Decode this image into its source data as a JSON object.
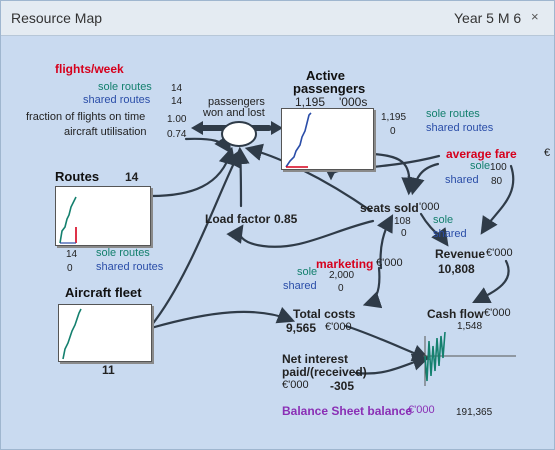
{
  "window": {
    "title": "Resource Map",
    "period": "Year 5 M 6",
    "close_glyph": "×"
  },
  "flights": {
    "title": "flights/week",
    "sole_label": "sole routes",
    "sole_value": "14",
    "shared_label": "shared routes",
    "shared_value": "14",
    "ontime_label": "fraction of flights on time",
    "ontime_value": "1.00",
    "util_label": "aircraft utilisation",
    "util_value": "0.74"
  },
  "flow": {
    "line1": "passengers",
    "line2": "won and lost"
  },
  "passengers": {
    "title_line1": "Active",
    "title_line2": "passengers",
    "total": "1,195",
    "unit": "'000s",
    "sole_value": "1,195",
    "shared_value": "0",
    "sole_label": "sole routes",
    "shared_label": "shared routes"
  },
  "fare": {
    "title": "average fare",
    "unit": "€",
    "sole_label": "sole",
    "sole_value": "100",
    "shared_label": "shared",
    "shared_value": "80"
  },
  "routes": {
    "title": "Routes",
    "value": "14",
    "sole_value": "14",
    "shared_value": "0",
    "sole_label": "sole routes",
    "shared_label": "shared routes"
  },
  "load_factor": {
    "label": "Load factor",
    "value": "0.85"
  },
  "seats": {
    "title": "seats sold",
    "unit": "'000",
    "sole_value": "108",
    "shared_value": "0",
    "sole_label": "sole",
    "shared_label": "shared"
  },
  "revenue": {
    "title": "Revenue",
    "unit": "€'000",
    "value": "10,808"
  },
  "marketing": {
    "title": "marketing",
    "unit": "€'000",
    "sole_label": "sole",
    "sole_value": "2,000",
    "shared_label": "shared",
    "shared_value": "0"
  },
  "fleet": {
    "title": "Aircraft fleet",
    "value": "11"
  },
  "costs": {
    "title": "Total costs",
    "value": "9,565",
    "unit": "€'000"
  },
  "cashflow": {
    "title": "Cash flow",
    "unit": "€'000",
    "value": "1,548"
  },
  "interest": {
    "line1": "Net interest",
    "line2": "paid/(received)",
    "unit": "€'000",
    "value": "-305"
  },
  "balance": {
    "label": "Balance Sheet balance",
    "unit": "€'000",
    "value": "191,365"
  },
  "colors": {
    "red": "#d6001c",
    "green": "#14806e",
    "blue": "#2a4da8",
    "purple": "#8a2fb5",
    "background": "#c9daf0"
  }
}
